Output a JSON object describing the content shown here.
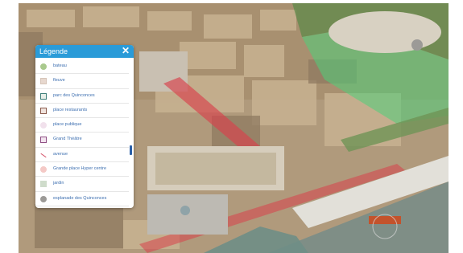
{
  "legend": {
    "title": "Légende",
    "close_glyph": "✕",
    "items": [
      {
        "label": "bateau",
        "shape": "circle",
        "fill": "#a9c98d",
        "stroke": "#a9c98d"
      },
      {
        "label": "fleuve",
        "shape": "square",
        "fill": "#e7d8cf",
        "stroke": "#d6c4b8"
      },
      {
        "label": "parc des Quinconces",
        "shape": "square",
        "fill": "#e8efe9",
        "stroke": "#3f7f7a"
      },
      {
        "label": "place restaurants",
        "shape": "square",
        "fill": "#efe2dc",
        "stroke": "#8a5a4c"
      },
      {
        "label": "place publique",
        "shape": "circle",
        "fill": "#f1e1ec",
        "stroke": "#f1e1ec"
      },
      {
        "label": "Grand Théâtre",
        "shape": "square",
        "fill": "#f2e4ef",
        "stroke": "#8f4f84"
      },
      {
        "label": "avenue",
        "shape": "line",
        "fill": "#d65a6f",
        "stroke": "#d65a6f"
      },
      {
        "label": "Grande place Hyper centre",
        "shape": "circle",
        "fill": "#f4c9c6",
        "stroke": "#f4c9c6"
      },
      {
        "label": "jardin",
        "shape": "square",
        "fill": "#cfdccb",
        "stroke": "#cfdccb"
      },
      {
        "label": "esplanade des Quinconces",
        "shape": "circle",
        "fill": "#9c9a97",
        "stroke": "#9c9a97"
      }
    ]
  },
  "colors": {
    "accent": "#2a9bd8",
    "avenue_highlight": "#d9414b",
    "park_overlay": "#4fd07a"
  }
}
